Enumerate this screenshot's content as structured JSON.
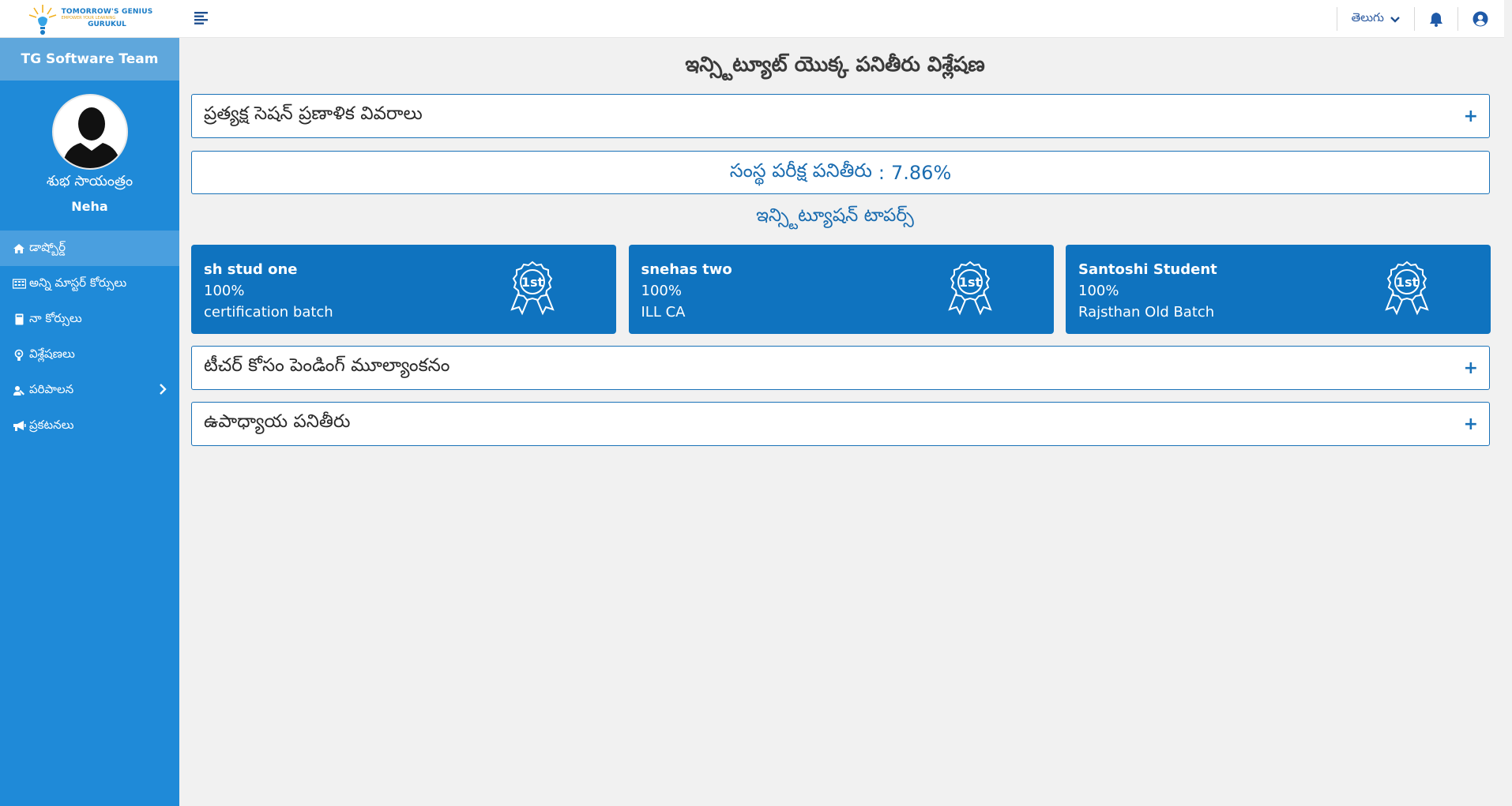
{
  "logo": {
    "line1": "TOMORROW'S GENIUS",
    "line2": "EMPOWER YOUR LEARNING",
    "line3": "GURUKUL"
  },
  "sidebar": {
    "team": "TG Software Team",
    "greeting": "శుభ సాయంత్రం",
    "user_name": "Neha",
    "items": [
      {
        "label": "డాష్బోర్డ్",
        "icon": "home-icon"
      },
      {
        "label": "అన్ని మాస్టర్ కోర్సులు",
        "icon": "courses-icon"
      },
      {
        "label": "నా కోర్సులు",
        "icon": "book-icon"
      },
      {
        "label": "విశ్లేషణలు",
        "icon": "analytics-icon"
      },
      {
        "label": "పరిపాలన",
        "icon": "admin-icon"
      },
      {
        "label": "ప్రకటనలు",
        "icon": "megaphone-icon"
      }
    ]
  },
  "topbar": {
    "language": "తెలుగు"
  },
  "main": {
    "title": "ఇన్స్టిట్యూట్ యొక్క పనితీరు విశ్లేషణ",
    "live_session_panel": "ప్రత్యక్ష సెషన్ ప్రణాళిక వివరాలు",
    "score_label": "సంస్థ పరీక్ష పనితీరు",
    "score_sep": ":",
    "score_value": "7.86%",
    "toppers_title": "ఇన్స్టిట్యూషన్ టాపర్స్",
    "toppers": [
      {
        "name": "sh stud one",
        "percent": "100%",
        "batch": "certification batch",
        "rank": "1st"
      },
      {
        "name": "snehas two",
        "percent": "100%",
        "batch": "ILL CA",
        "rank": "1st"
      },
      {
        "name": "Santoshi Student",
        "percent": "100%",
        "batch": "Rajsthan Old Batch",
        "rank": "1st"
      }
    ],
    "pending_panel": "టీచర్ కోసం పెండింగ్ మూల్యాంకనం",
    "teacher_panel": "ఉపాధ్యాయ పనితీరు",
    "expand_symbol": "+"
  },
  "colors": {
    "sidebar": "#1f8ad8",
    "card": "#0f73bf",
    "accent": "#1a72b8"
  }
}
